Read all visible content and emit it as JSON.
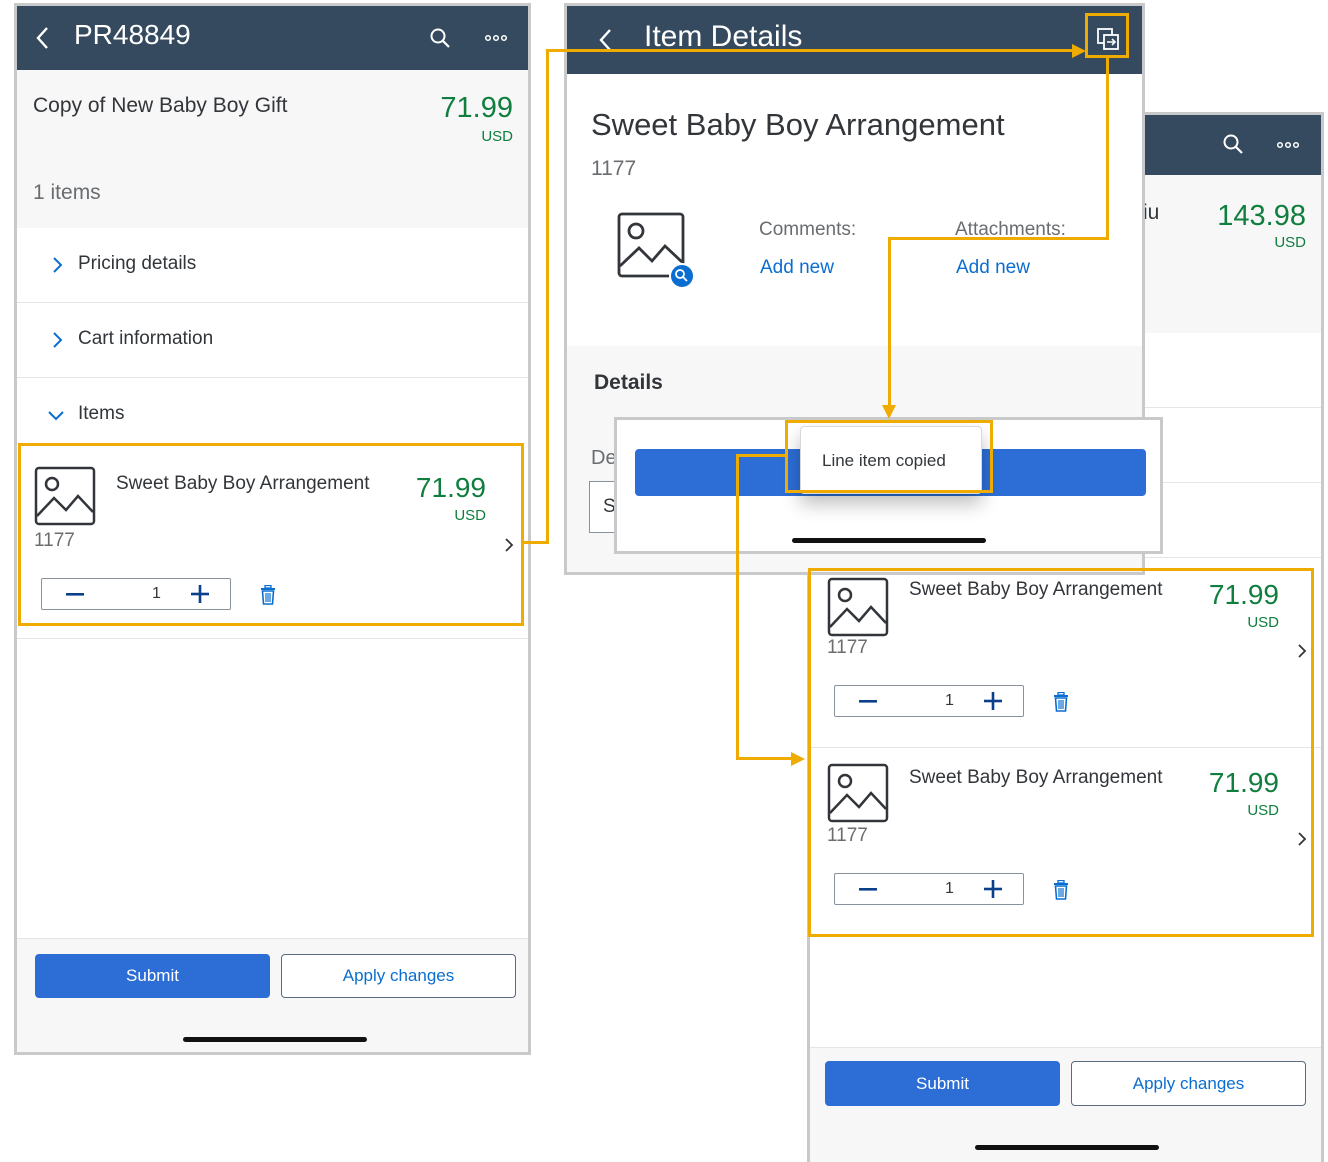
{
  "screen1": {
    "header": {
      "title": "PR48849"
    },
    "cart": {
      "name": "Copy of New Baby Boy Gift",
      "price": "71.99",
      "currency": "USD",
      "item_count": "1 items"
    },
    "sections": [
      {
        "label": "Pricing details"
      },
      {
        "label": "Cart information"
      },
      {
        "label": "Items"
      }
    ],
    "item": {
      "name": "Sweet Baby Boy Arrangement",
      "id": "1177",
      "price": "71.99",
      "currency": "USD",
      "quantity": "1"
    },
    "footer": {
      "submit": "Submit",
      "apply": "Apply changes"
    }
  },
  "screen2": {
    "header": {
      "title": "Item Details"
    },
    "item": {
      "name": "Sweet Baby Boy Arrangement",
      "id": "1177"
    },
    "comments": {
      "label": "Comments:",
      "link": "Add new"
    },
    "attachments": {
      "label": "Attachments:",
      "link": "Add new"
    },
    "details": {
      "title": "Details",
      "field_label_partial": "De",
      "field_value_partial": "S"
    },
    "toast": {
      "message": "Line item copied"
    }
  },
  "screen3": {
    "header_partial": {
      "cart_name_partial": "iu",
      "price": "143.98",
      "currency": "USD"
    },
    "items": [
      {
        "name": "Sweet Baby Boy Arrangement",
        "id": "1177",
        "price": "71.99",
        "currency": "USD",
        "quantity": "1"
      },
      {
        "name": "Sweet Baby Boy Arrangement",
        "id": "1177",
        "price": "71.99",
        "currency": "USD",
        "quantity": "1"
      }
    ],
    "footer": {
      "submit": "Submit",
      "apply": "Apply changes"
    }
  },
  "icons": [
    "back-icon",
    "search-icon",
    "more-icon",
    "chevron-right-icon",
    "chevron-down-icon",
    "image-placeholder-icon",
    "minus-icon",
    "plus-icon",
    "trash-icon",
    "copy-icon"
  ],
  "colors": {
    "shell": "#354a5f",
    "accent": "#2c6ed5",
    "price": "#107e3e",
    "highlight": "#f0ab00",
    "link": "#0a6ed1"
  }
}
